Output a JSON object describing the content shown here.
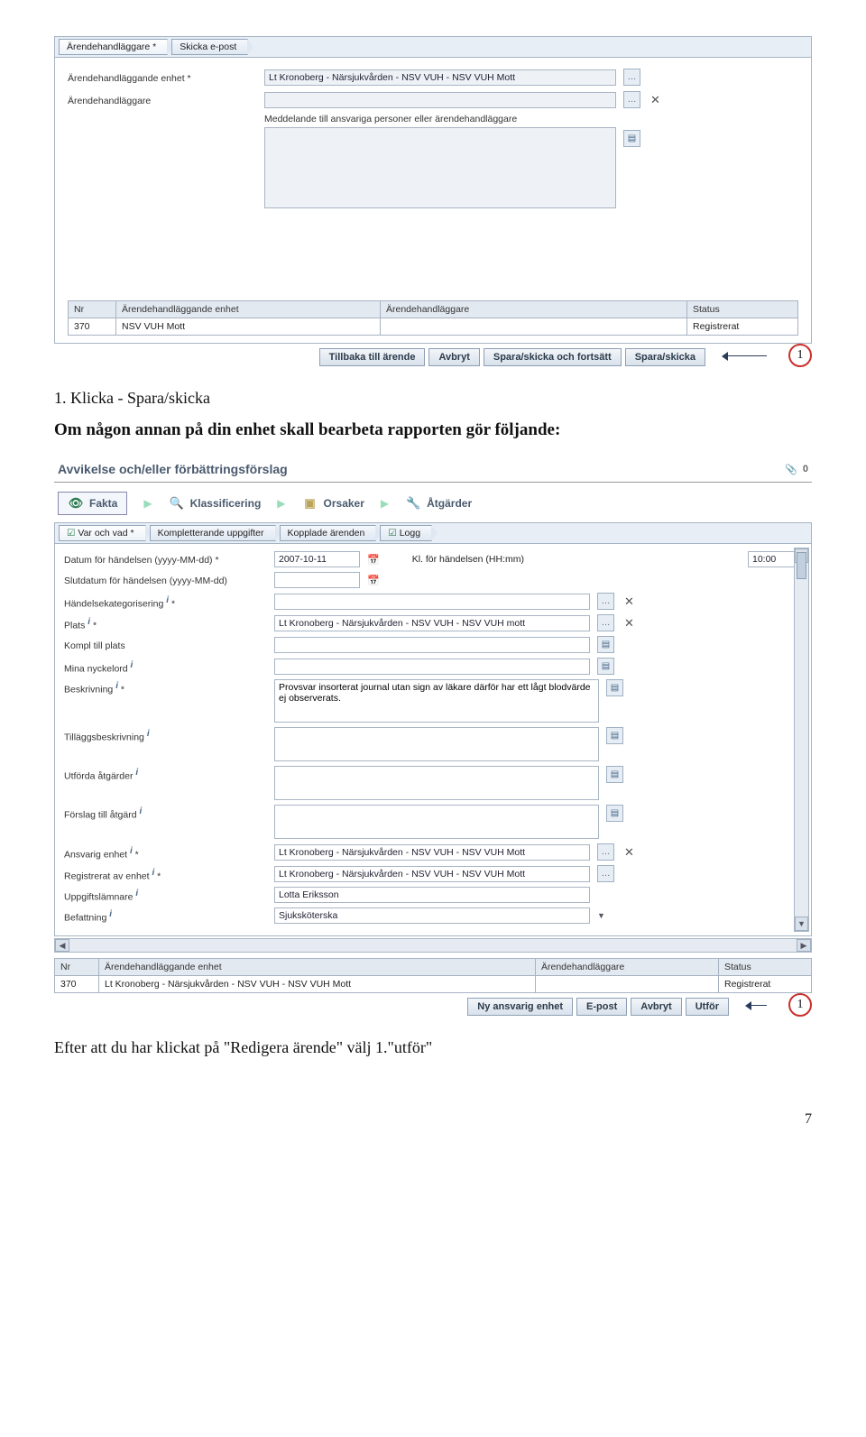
{
  "shot1": {
    "crumbs": [
      "Ärendehandläggare *",
      "Skicka e-post"
    ],
    "fields": {
      "unit_label": "Ärendehandläggande enhet *",
      "unit_value": "Lt Kronoberg - Närsjukvården - NSV VUH - NSV VUH Mott",
      "handler_label": "Ärendehandläggare",
      "handler_value": "",
      "msg_label": "Meddelande till ansvariga personer eller ärendehandläggare",
      "msg_value": ""
    },
    "table": {
      "headers": [
        "Nr",
        "Ärendehandläggande enhet",
        "Ärendehandläggare",
        "Status"
      ],
      "row": [
        "370",
        "NSV VUH Mott",
        "",
        "Registrerat"
      ]
    },
    "buttons": [
      "Tillbaka till ärende",
      "Avbryt",
      "Spara/skicka och fortsätt",
      "Spara/skicka"
    ]
  },
  "text": {
    "line1": "1. Klicka - Spara/skicka",
    "line2": "Om någon annan på din enhet skall bearbeta rapporten gör följande:",
    "line3": "Efter att du har klickat på \"Redigera ärende\" välj  1.\"utför\"",
    "callout1": "1",
    "callout2": "1",
    "pagenum": "7"
  },
  "shot2": {
    "title": "Avvikelse och/eller förbättringsförslag",
    "title_badge": "0",
    "bigtabs": [
      {
        "label": "Fakta"
      },
      {
        "label": "Klassificering"
      },
      {
        "label": "Orsaker"
      },
      {
        "label": "Åtgärder"
      }
    ],
    "subcrumbs": [
      "Var och vad *",
      "Kompletterande uppgifter",
      "Kopplade ärenden",
      "Logg"
    ],
    "form": {
      "date_label": "Datum för händelsen (yyyy-MM-dd) *",
      "date_value": "2007-10-11",
      "time_label": "Kl. för händelsen (HH:mm)",
      "time_value": "10:00",
      "enddate_label": "Slutdatum för händelsen (yyyy-MM-dd)",
      "enddate_value": "",
      "cat_label": "Händelsekategorisering",
      "cat_value": "",
      "plats_label": "Plats",
      "plats_value": "Lt Kronoberg - Närsjukvården - NSV VUH - NSV VUH mott",
      "kompl_label": "Kompl till plats",
      "kompl_value": "",
      "keys_label": "Mina nyckelord",
      "keys_value": "",
      "desc_label": "Beskrivning",
      "desc_value": "Provsvar insorterat journal utan sign av läkare därför har ett lågt blodvärde ej observerats.",
      "tillagg_label": "Tilläggsbeskrivning",
      "tillagg_value": "",
      "utforda_label": "Utförda åtgärder",
      "utforda_value": "",
      "forslag_label": "Förslag till åtgärd",
      "forslag_value": "",
      "ansvarig_label": "Ansvarig enhet",
      "ansvarig_value": "Lt Kronoberg - Närsjukvården - NSV VUH - NSV VUH Mott",
      "regav_label": "Registrerat av enhet",
      "regav_value": "Lt Kronoberg - Närsjukvården - NSV VUH - NSV VUH Mott",
      "uppgift_label": "Uppgiftslämnare",
      "uppgift_value": "Lotta Eriksson",
      "befattning_label": "Befattning",
      "befattning_value": "Sjuksköterska"
    },
    "table": {
      "headers": [
        "Nr",
        "Ärendehandläggande enhet",
        "Ärendehandläggare",
        "Status"
      ],
      "row": [
        "370",
        "Lt Kronoberg - Närsjukvården - NSV VUH - NSV VUH Mott",
        "",
        "Registrerat"
      ]
    },
    "buttons": [
      "Ny ansvarig enhet",
      "E-post",
      "Avbryt",
      "Utför"
    ]
  }
}
